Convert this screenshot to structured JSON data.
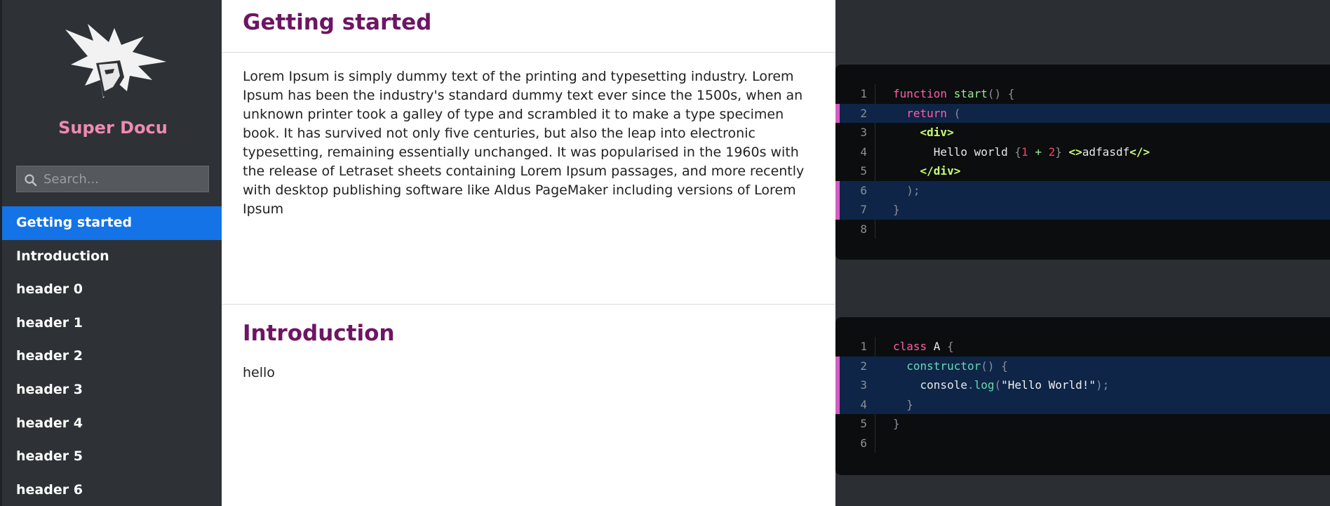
{
  "sidebar": {
    "brand": "Super Docu",
    "search_placeholder": "Search...",
    "items": [
      {
        "label": "Getting started"
      },
      {
        "label": "Introduction"
      },
      {
        "label": "header 0"
      },
      {
        "label": "header 1"
      },
      {
        "label": "header 2"
      },
      {
        "label": "header 3"
      },
      {
        "label": "header 4"
      },
      {
        "label": "header 5"
      },
      {
        "label": "header 6"
      }
    ],
    "active_index": 0
  },
  "sections": [
    {
      "title": "Getting started",
      "body": "Lorem Ipsum is simply dummy text of the printing and typesetting industry. Lorem Ipsum has been the industry's standard dummy text ever since the 1500s, when an unknown printer took a galley of type and scrambled it to make a type specimen book. It has survived not only five centuries, but also the leap into electronic typesetting, remaining essentially unchanged. It was popularised in the 1960s with the release of Letraset sheets containing Lorem Ipsum passages, and more recently with desktop publishing software like Aldus PageMaker including versions of Lorem Ipsum"
    },
    {
      "title": "Introduction",
      "body": "hello"
    }
  ],
  "code_blocks": [
    {
      "highlighted_lines": [
        2,
        6,
        7
      ],
      "lines": [
        {
          "n": "1",
          "indent": "",
          "tokens": [
            [
              "kw",
              "function"
            ],
            [
              "",
              ""
            ],
            [
              "txt",
              " "
            ],
            [
              "fn",
              "start"
            ],
            [
              "punc",
              "()"
            ],
            [
              "txt",
              " "
            ],
            [
              "punc",
              "{"
            ]
          ]
        },
        {
          "n": "2",
          "indent": "  ",
          "tokens": [
            [
              "kw",
              "return"
            ],
            [
              "txt",
              " "
            ],
            [
              "punc",
              "("
            ]
          ]
        },
        {
          "n": "3",
          "indent": "    ",
          "tokens": [
            [
              "tag",
              "<div>"
            ]
          ]
        },
        {
          "n": "4",
          "indent": "      ",
          "tokens": [
            [
              "txt",
              "Hello world "
            ],
            [
              "punc",
              "{"
            ],
            [
              "num",
              "1"
            ],
            [
              "txt",
              " "
            ],
            [
              "fn",
              "+"
            ],
            [
              "txt",
              " "
            ],
            [
              "num",
              "2"
            ],
            [
              "punc",
              "}"
            ],
            [
              "txt",
              " "
            ],
            [
              "tag",
              "<>"
            ],
            [
              "txt",
              "adfasdf"
            ],
            [
              "tag",
              "</>"
            ]
          ]
        },
        {
          "n": "5",
          "indent": "    ",
          "tokens": [
            [
              "tag",
              "</div>"
            ]
          ]
        },
        {
          "n": "6",
          "indent": "  ",
          "tokens": [
            [
              "punc",
              ");"
            ]
          ]
        },
        {
          "n": "7",
          "indent": "",
          "tokens": [
            [
              "punc",
              "}"
            ]
          ]
        },
        {
          "n": "8",
          "indent": "",
          "tokens": []
        }
      ]
    },
    {
      "highlighted_lines": [
        2,
        3,
        4
      ],
      "lines": [
        {
          "n": "1",
          "indent": "",
          "tokens": [
            [
              "kw",
              "class"
            ],
            [
              "txt",
              " A "
            ],
            [
              "punc",
              "{"
            ]
          ]
        },
        {
          "n": "2",
          "indent": "  ",
          "tokens": [
            [
              "ac",
              "constructor"
            ],
            [
              "punc",
              "()"
            ],
            [
              "txt",
              " "
            ],
            [
              "punc",
              "{"
            ]
          ]
        },
        {
          "n": "3",
          "indent": "    ",
          "tokens": [
            [
              "txt",
              "console"
            ],
            [
              "punc",
              "."
            ],
            [
              "ac",
              "log"
            ],
            [
              "punc",
              "("
            ],
            [
              "str",
              "\"Hello World!\""
            ],
            [
              "punc",
              ");"
            ]
          ]
        },
        {
          "n": "4",
          "indent": "  ",
          "tokens": [
            [
              "punc",
              "}"
            ]
          ]
        },
        {
          "n": "5",
          "indent": "",
          "tokens": [
            [
              "punc",
              "}"
            ]
          ]
        },
        {
          "n": "6",
          "indent": "",
          "tokens": []
        }
      ]
    }
  ],
  "colors": {
    "accent": "#1473e6",
    "brand": "#f08ab0",
    "heading": "#6e1563",
    "highlight_bar": "#d45cc4"
  }
}
